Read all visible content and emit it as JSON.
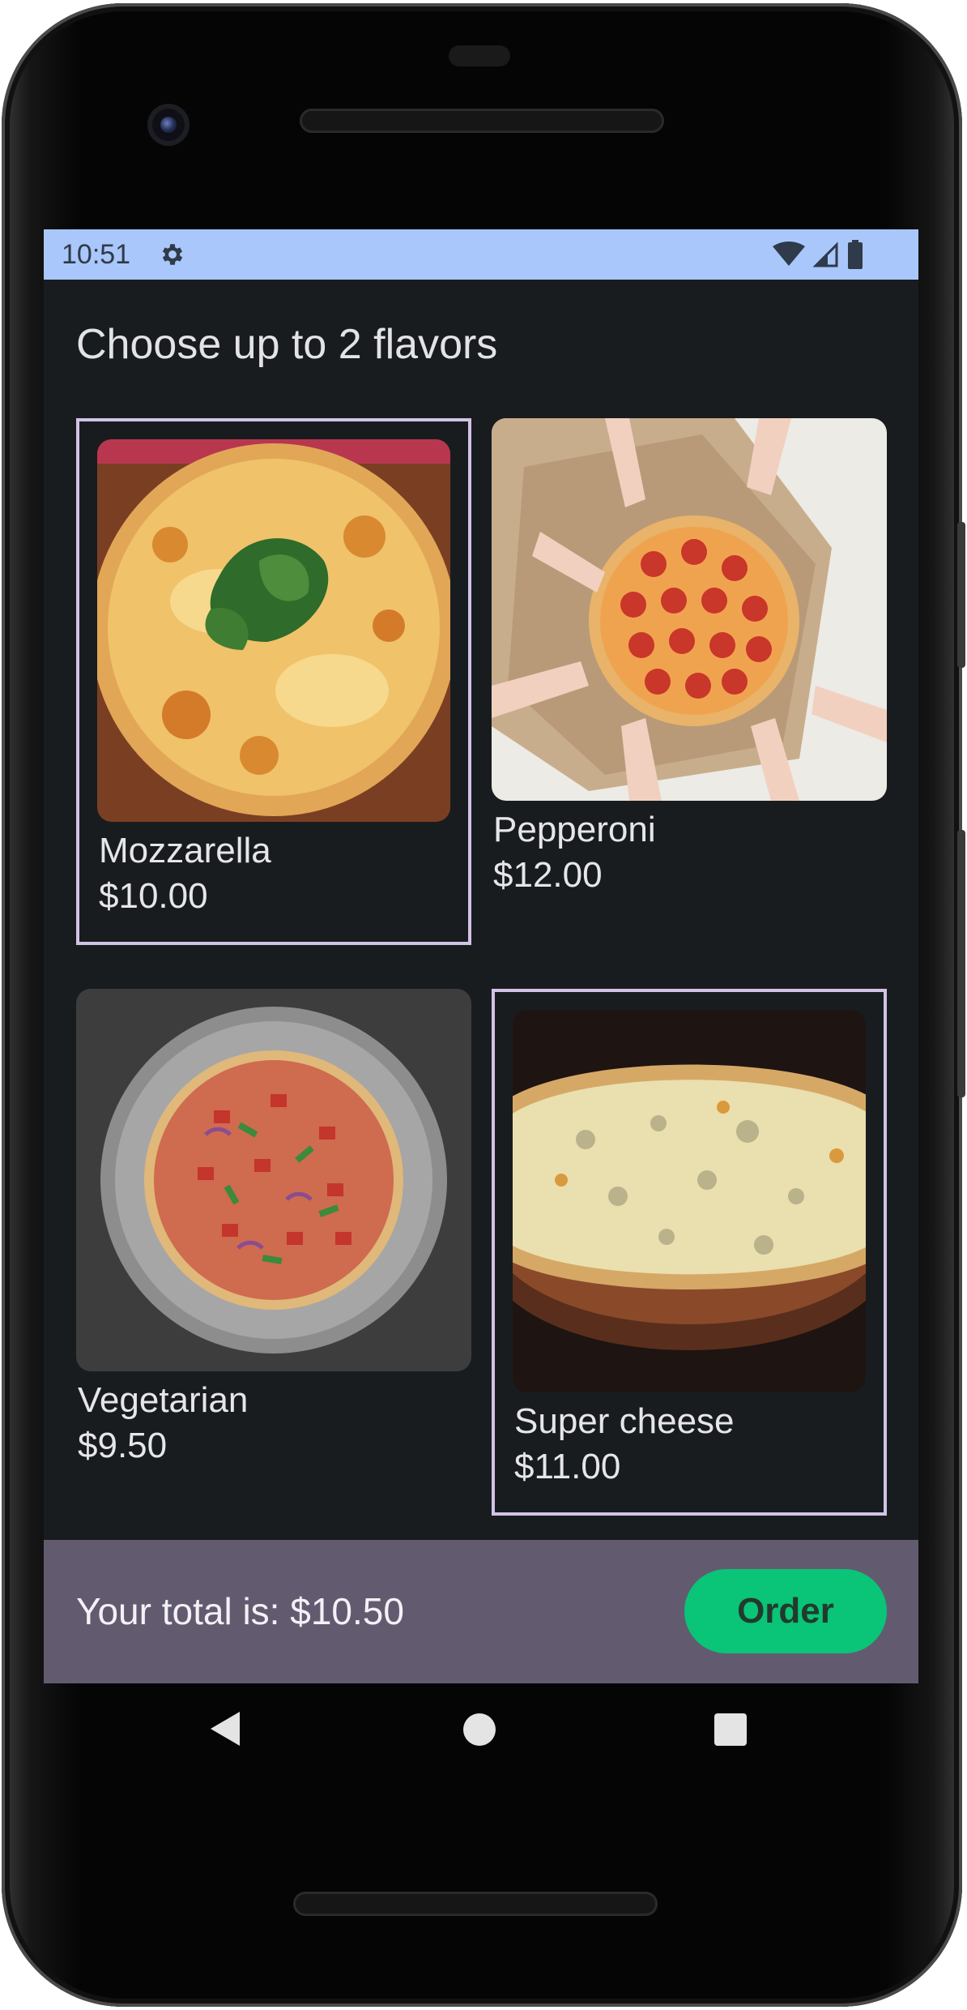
{
  "status_bar": {
    "time": "10:51",
    "icons": [
      "gear-icon",
      "wifi-icon",
      "signal-icon",
      "battery-icon"
    ]
  },
  "heading": "Choose up to 2 flavors",
  "flavors": [
    {
      "name": "Mozzarella",
      "price": "$10.00",
      "selected": true,
      "image": "mozzarella-pizza-photo"
    },
    {
      "name": "Pepperoni",
      "price": "$12.00",
      "selected": false,
      "image": "pepperoni-pizza-photo"
    },
    {
      "name": "Vegetarian",
      "price": "$9.50",
      "selected": false,
      "image": "vegetarian-pizza-photo"
    },
    {
      "name": "Super cheese",
      "price": "$11.00",
      "selected": true,
      "image": "super-cheese-pizza-photo"
    }
  ],
  "bottom_bar": {
    "total": "Your total is: $10.50",
    "order_label": "Order"
  },
  "navigation": {
    "buttons": [
      "back-icon",
      "home-icon",
      "recents-icon"
    ]
  },
  "colors": {
    "status_bar": "#aac7fb",
    "screen_bg": "#191c1f",
    "selection_border": "#d2c3e6",
    "bottom_bar": "#625b70",
    "order_button": "#0ac477"
  }
}
